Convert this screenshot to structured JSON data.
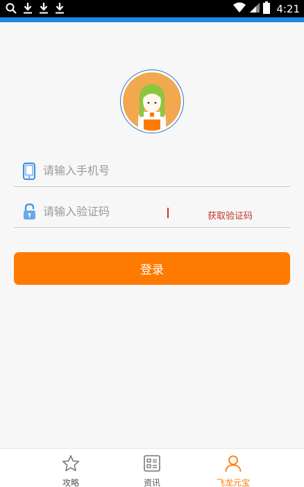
{
  "status_bar": {
    "time": "4:21",
    "left_icons": [
      "search-icon",
      "download-icon",
      "download-icon",
      "download-icon"
    ],
    "right_icons": [
      "wifi-icon",
      "signal-icon",
      "battery-icon"
    ]
  },
  "colors": {
    "accent": "#1e88e5",
    "brand_orange": "#ff7a00",
    "code_link": "#c0392b"
  },
  "login_form": {
    "phone": {
      "placeholder": "请输入手机号",
      "value": "",
      "icon": "phone-icon"
    },
    "code": {
      "placeholder": "请输入验证码",
      "value": "",
      "icon": "lock-icon"
    },
    "get_code_label": "获取验证码",
    "submit_label": "登录"
  },
  "bottom_nav": {
    "items": [
      {
        "label": "攻略",
        "icon": "star-icon",
        "active": false
      },
      {
        "label": "资讯",
        "icon": "news-icon",
        "active": false
      },
      {
        "label": "飞龙元宝",
        "icon": "user-icon",
        "active": true
      }
    ]
  }
}
